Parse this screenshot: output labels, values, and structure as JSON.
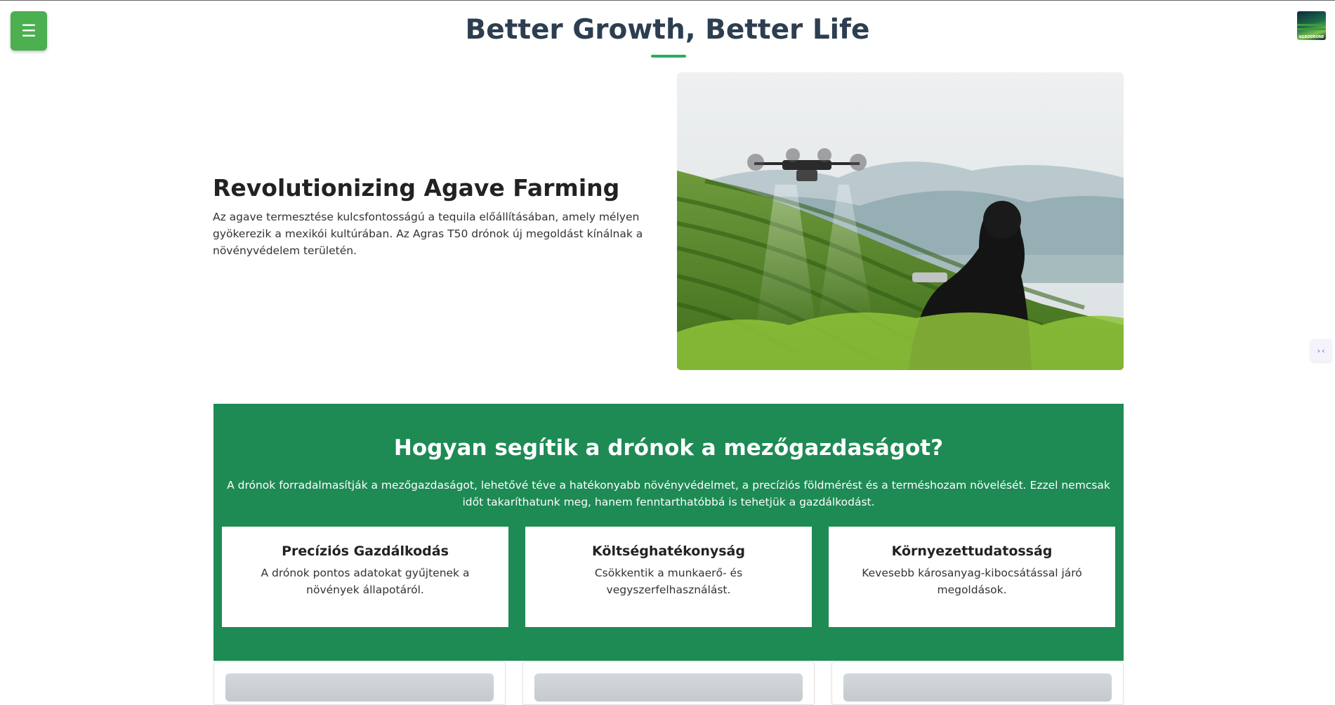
{
  "menu": {
    "icon": "hamburger-icon",
    "glyph": "☰"
  },
  "logo": {
    "text": "AGRODRONE"
  },
  "header": {
    "title": "Better Growth, Better Life"
  },
  "hero": {
    "title": "Revolutionizing Agave Farming",
    "description": "Az agave termesztése kulcsfontosságú a tequila előállításában, amely mélyen gyökerezik a mexikói kultúrában. Az Agras T50 drónok új megoldást kínálnak a növényvédelem területén."
  },
  "benefits": {
    "title": "Hogyan segítik a drónok a mezőgazdaságot?",
    "description": "A drónok forradalmasítják a mezőgazdaságot, lehetővé téve a hatékonyabb növényvédelmet, a precíziós földmérést és a terméshozam növelését. Ezzel nemcsak időt takaríthatunk meg, hanem fenntarthatóbbá is tehetjük a gazdálkodást.",
    "cards": [
      {
        "title": "Precíziós Gazdálkodás",
        "text": "A drónok pontos adatokat gyűjtenek a növények állapotáról."
      },
      {
        "title": "Költséghatékonyság",
        "text": "Csökkentik a munkaerő- és vegyszerfelhasználást."
      },
      {
        "title": "Környezettudatosság",
        "text": "Kevesebb károsanyag-kibocsátással járó megoldások."
      }
    ]
  },
  "side_widget": {
    "icon": "translate-widget-icon",
    "glyph": "›‹"
  },
  "colors": {
    "primary_green": "#1e8a54",
    "menu_green": "#4caf50",
    "title_color": "#2c3e50",
    "accent": "#27ae60"
  }
}
